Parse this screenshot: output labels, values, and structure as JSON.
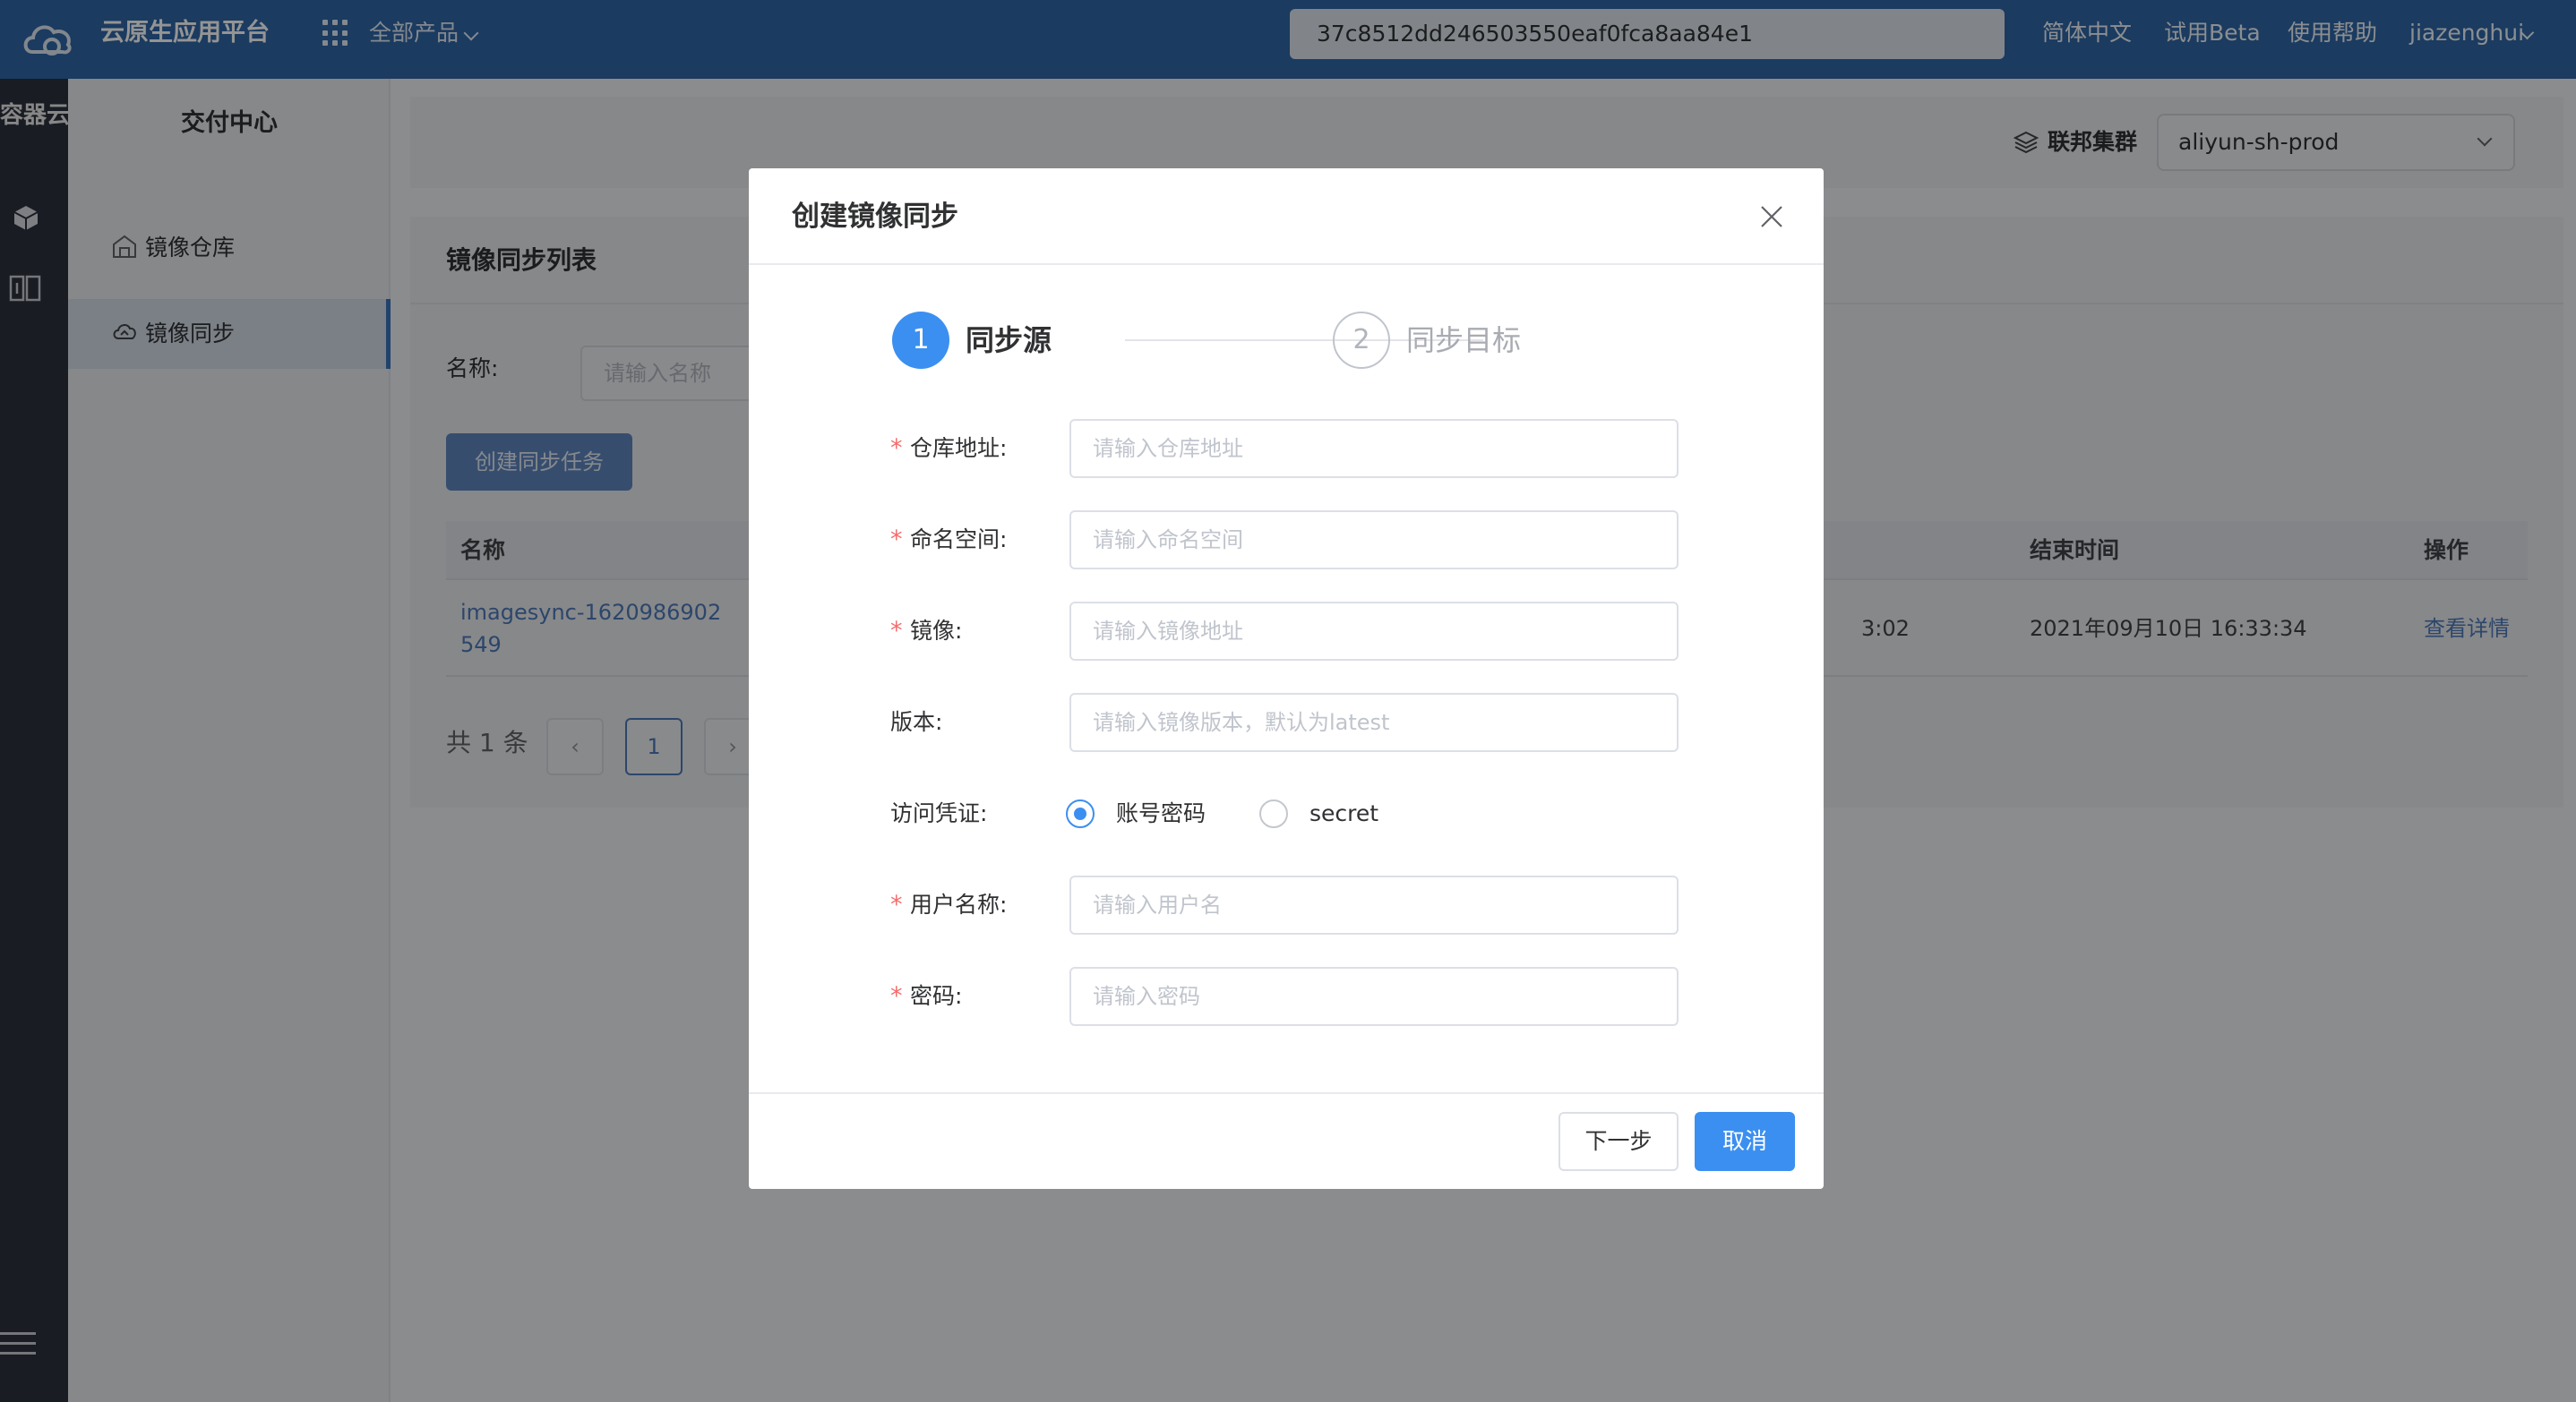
{
  "topbar": {
    "brand": "云原生应用平台",
    "all_products": "全部产品",
    "search_value": "37c8512dd246503550eaf0fca8aa84e1",
    "links": [
      "简体中文",
      "试用Beta",
      "使用帮助"
    ],
    "user": "jiazenghui"
  },
  "rail": {
    "title": "容器云"
  },
  "sidebar": {
    "title": "交付中心",
    "items": [
      {
        "label": "镜像仓库",
        "icon": "warehouse-icon",
        "active": false
      },
      {
        "label": "镜像同步",
        "icon": "cloud-sync-icon",
        "active": true
      }
    ]
  },
  "cluster": {
    "label": "联邦集群",
    "value": "aliyun-sh-prod"
  },
  "list": {
    "title": "镜像同步列表",
    "filter_label": "名称:",
    "filter_placeholder": "请输入名称",
    "create_button": "创建同步任务",
    "columns": [
      "名称",
      "结束时间",
      "操作"
    ],
    "rows": [
      {
        "name": "imagesync-1620986902549",
        "start_time_partial": "3:02",
        "end_time": "2021年09月10日 16:33:34",
        "action": "查看详情"
      }
    ],
    "total": "共 1 条",
    "page_prev": "‹",
    "page_current": "1",
    "page_next": "›"
  },
  "modal": {
    "title": "创建镜像同步",
    "steps": [
      {
        "number": "1",
        "label": "同步源",
        "active": true
      },
      {
        "number": "2",
        "label": "同步目标",
        "active": false
      }
    ],
    "fields": {
      "repo_address": {
        "label": "仓库地址:",
        "placeholder": "请输入仓库地址",
        "required": true
      },
      "namespace": {
        "label": "命名空间:",
        "placeholder": "请输入命名空间",
        "required": true
      },
      "image": {
        "label": "镜像:",
        "placeholder": "请输入镜像地址",
        "required": true
      },
      "version": {
        "label": "版本:",
        "placeholder": "请输入镜像版本，默认为latest",
        "required": false
      },
      "credential": {
        "label": "访问凭证:",
        "options": [
          "账号密码",
          "secret"
        ],
        "selected": "账号密码"
      },
      "username": {
        "label": "用户名称:",
        "placeholder": "请输入用户名",
        "required": true
      },
      "password": {
        "label": "密码:",
        "placeholder": "请输入密码",
        "required": true
      }
    },
    "required_mark": "*",
    "next_button": "下一步",
    "cancel_button": "取消"
  },
  "colors": {
    "topbar": "#2f67a6",
    "primary": "#3b8ff0",
    "rail": "#2b313d",
    "required": "#f56c6c"
  }
}
